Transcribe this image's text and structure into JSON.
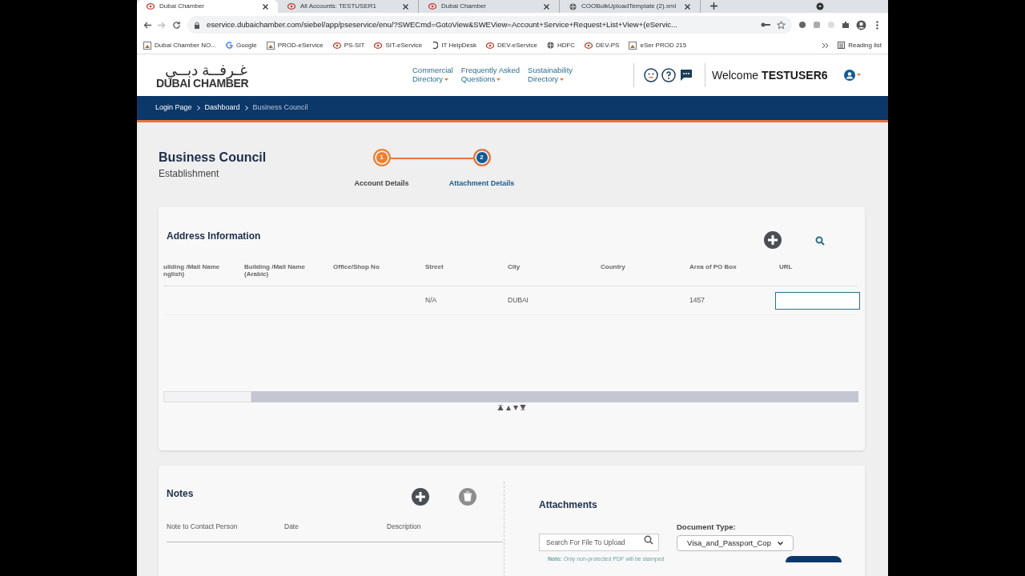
{
  "browser": {
    "tabs": [
      {
        "title": "Dubai Chamber",
        "selected": true,
        "kind": "site"
      },
      {
        "title": "All Accounts: TESTUSER1",
        "selected": false,
        "kind": "site"
      },
      {
        "title": "Dubai Chamber",
        "selected": false,
        "kind": "site"
      },
      {
        "title": "COOBulkUploadTemplate (2).xml",
        "selected": false,
        "kind": "globe"
      }
    ],
    "address": "eservice.dubaichamber.com/siebel/app/pseservice/enu/?SWECmd=GotoView&SWEView=Account+Service+Request+List+View+(eServic...",
    "bookmarks": [
      {
        "label": "Dubai Chamber NO...",
        "kind": "page"
      },
      {
        "label": "Google",
        "kind": "google"
      },
      {
        "label": "PROD-eService",
        "kind": "page"
      },
      {
        "label": "PS-SIT",
        "kind": "site"
      },
      {
        "label": "SIT-eService",
        "kind": "site"
      },
      {
        "label": "IT HelpDesk",
        "kind": "spinner"
      },
      {
        "label": "DEV-eService",
        "kind": "site"
      },
      {
        "label": "HDFC",
        "kind": "globe"
      },
      {
        "label": "DEV-PS",
        "kind": "site"
      },
      {
        "label": "eSer PROD 215",
        "kind": "page"
      }
    ],
    "reading_list": "Reading list"
  },
  "header": {
    "logo_arabic": "غـرفــة دبــي",
    "logo_english": "DUBAI CHAMBER",
    "links": [
      {
        "line1": "Commercial",
        "line2": "Directory"
      },
      {
        "line1": "Frequently Asked",
        "line2": "Questions"
      },
      {
        "line1": "Sustainability",
        "line2": "Directory"
      }
    ],
    "welcome": "Welcome",
    "user": "TESTUSER6"
  },
  "breadcrumb": [
    {
      "label": "Login Page",
      "current": false
    },
    {
      "label": "Dashboard",
      "current": false
    },
    {
      "label": "Business Council",
      "current": true
    }
  ],
  "page": {
    "title": "Business Council",
    "subtitle": "Establishment"
  },
  "steps": [
    {
      "number": "1",
      "label": "Account Details",
      "selected": false
    },
    {
      "number": "2",
      "label": "Attachment Details",
      "selected": true
    }
  ],
  "address_information": {
    "title": "Address Information",
    "columns": [
      "uilding /Mall Name nglish)",
      "Building /Mall Name (Arabic)",
      "Office/Shop No",
      "Street",
      "City",
      "Country",
      "Area of PO Box",
      "URL"
    ],
    "rows": [
      {
        "cells": [
          "",
          "",
          "",
          "N/A",
          "DUBAI",
          "",
          "1457"
        ],
        "url_focused": true
      }
    ]
  },
  "notes": {
    "title": "Notes",
    "columns": [
      "Note to Contact Person",
      "Date",
      "Description"
    ]
  },
  "attachments": {
    "title": "Attachments",
    "search_placeholder": "Search For File To Upload",
    "document_type_label": "Document Type:",
    "document_type": "Visa_and_Passport_Cop",
    "note_bold": "Note:",
    "note": "Only non-protected PDF will be stamped"
  }
}
